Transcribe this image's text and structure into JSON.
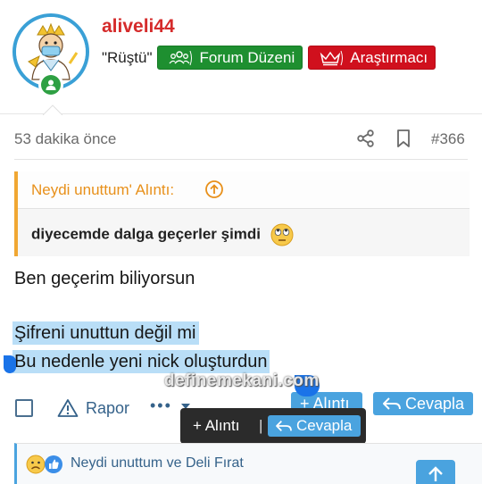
{
  "user": {
    "name": "aliveli44",
    "title": "\"Rüştü\"",
    "badges": [
      {
        "label": "Forum Düzeni",
        "color": "#1e8f30",
        "icon": "group-icon"
      },
      {
        "label": "Araştırmacı",
        "color": "#d0101d",
        "icon": "crown-icon"
      }
    ]
  },
  "post": {
    "time": "53 dakika önce",
    "number": "#366"
  },
  "quote": {
    "header": "Neydi unuttum' Alıntı:",
    "body": "diyecemde dalga geçerler şimdi"
  },
  "message": {
    "line1": "Ben geçerim biliyorsun",
    "line2": "Şifreni unuttun değil mi",
    "line3": "Bu nedenle yeni nick oluşturdun"
  },
  "actions": {
    "report": "Rapor",
    "more": "•••",
    "quote": "Alıntı",
    "reply": "Cevapla"
  },
  "popup": {
    "quote": "+ Alıntı",
    "separator": "|",
    "reply": "Cevapla"
  },
  "watermark": "definemekani.com",
  "reactions": {
    "names": "Neydi unuttum ve Deli Fırat"
  },
  "colors": {
    "accent": "#4aa3df",
    "username": "#d52b2b",
    "quote_border": "#f0a733"
  }
}
